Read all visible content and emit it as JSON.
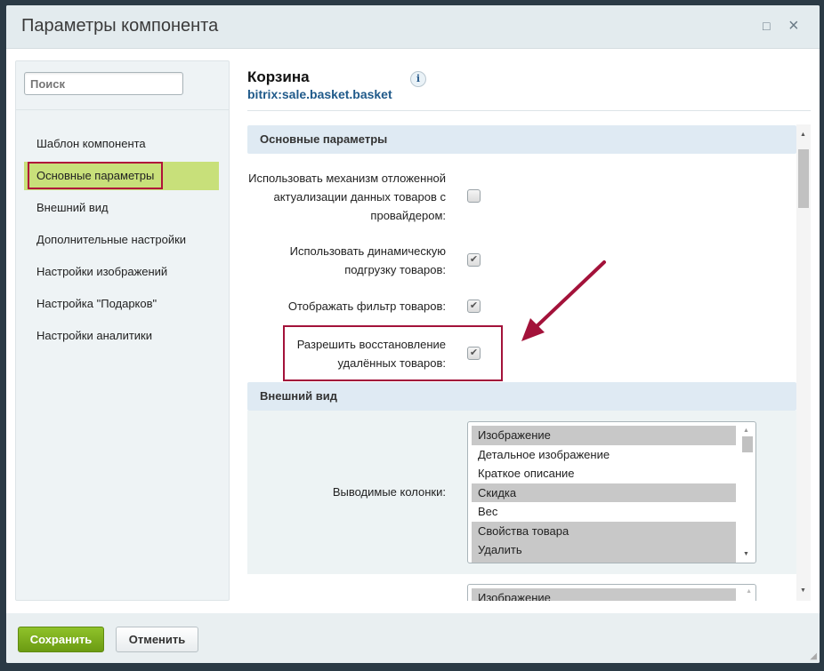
{
  "dialog": {
    "title": "Параметры компонента",
    "maximize_icon": "□",
    "close_icon": "×"
  },
  "sidebar": {
    "search_placeholder": "Поиск",
    "items": [
      {
        "label": "Шаблон компонента"
      },
      {
        "label": "Основные параметры",
        "selected": true
      },
      {
        "label": "Внешний вид"
      },
      {
        "label": "Дополнительные настройки"
      },
      {
        "label": "Настройки изображений"
      },
      {
        "label": "Настройка \"Подарков\""
      },
      {
        "label": "Настройки аналитики"
      }
    ]
  },
  "component": {
    "name": "Корзина",
    "code": "bitrix:sale.basket.basket",
    "info": "i"
  },
  "sections": {
    "main": {
      "title": "Основные параметры",
      "params": [
        {
          "label": "Использовать механизм отложенной актуализации данных товаров с провайдером:",
          "checked": false
        },
        {
          "label": "Использовать динамическую подгрузку товаров:",
          "checked": true
        },
        {
          "label": "Отображать фильтр товаров:",
          "checked": true
        },
        {
          "label": "Разрешить восстановление удалённых товаров:",
          "checked": true
        }
      ]
    },
    "view": {
      "title": "Внешний вид",
      "columns_label": "Выводимые колонки:",
      "columns_options": [
        {
          "label": "Изображение",
          "selected": true
        },
        {
          "label": "Детальное изображение",
          "selected": false
        },
        {
          "label": "Краткое описание",
          "selected": false
        },
        {
          "label": "Скидка",
          "selected": true
        },
        {
          "label": "Вес",
          "selected": false
        },
        {
          "label": "Свойства товара",
          "selected": true
        },
        {
          "label": "Удалить",
          "selected": true
        }
      ],
      "second_list_options": [
        {
          "label": "Изображение",
          "selected": true
        }
      ]
    }
  },
  "check_mark": "✔",
  "footer": {
    "save": "Сохранить",
    "cancel": "Отменить"
  },
  "colors": {
    "accent_green": "#8fc22a",
    "highlight": "#a3123a",
    "selected_item": "#c8e07a"
  }
}
